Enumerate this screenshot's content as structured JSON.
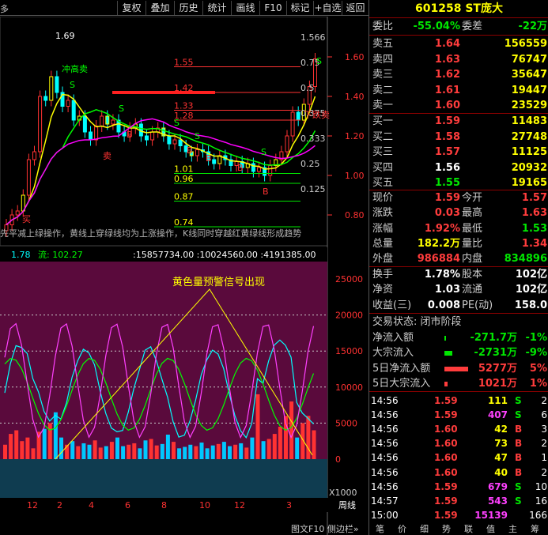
{
  "toolbar": {
    "left_label": "多",
    "buttons": [
      "复权",
      "叠加",
      "历史",
      "统计",
      "画线",
      "F10",
      "标记",
      "+自选",
      "返回"
    ]
  },
  "stock": {
    "code": "601258",
    "name": "ST庞大"
  },
  "order_book": {
    "weibi_label": "委比",
    "weibi": "-55.04%",
    "weicha_label": "委差",
    "weicha": "-22万",
    "asks": [
      {
        "label": "卖五",
        "price": "1.64",
        "vol": "156559"
      },
      {
        "label": "卖四",
        "price": "1.63",
        "vol": "76747"
      },
      {
        "label": "卖三",
        "price": "1.62",
        "vol": "35647"
      },
      {
        "label": "卖二",
        "price": "1.61",
        "vol": "19447"
      },
      {
        "label": "卖一",
        "price": "1.60",
        "vol": "23529"
      }
    ],
    "bids": [
      {
        "label": "买一",
        "price": "1.59",
        "vol": "11483"
      },
      {
        "label": "买二",
        "price": "1.58",
        "vol": "27748"
      },
      {
        "label": "买三",
        "price": "1.57",
        "vol": "11125"
      },
      {
        "label": "买四",
        "price": "1.56",
        "vol": "20932"
      },
      {
        "label": "买五",
        "price": "1.55",
        "vol": "19165"
      }
    ]
  },
  "quote": [
    {
      "l1": "现价",
      "v1": "1.59",
      "l2": "今开",
      "v2": "1.57"
    },
    {
      "l1": "涨跌",
      "v1": "0.03",
      "l2": "最高",
      "v2": "1.63"
    },
    {
      "l1": "涨幅",
      "v1": "1.92%",
      "l2": "最低",
      "v2": "1.53"
    },
    {
      "l1": "总量",
      "v1": "182.2万",
      "l2": "量比",
      "v2": "1.34"
    },
    {
      "l1": "外盘",
      "v1": "986884",
      "l2": "内盘",
      "v2": "834896"
    }
  ],
  "stats": [
    {
      "l1": "换手",
      "v1": "1.78%",
      "l2": "股本",
      "v2": "102亿"
    },
    {
      "l1": "净资",
      "v1": "1.03",
      "l2": "流通",
      "v2": "102亿"
    },
    {
      "l1": "收益(三)",
      "v1": "0.008",
      "l2": "PE(动)",
      "v2": "158.0"
    }
  ],
  "status": "交易状态: 闭市阶段",
  "flows": [
    {
      "label": "净流入额",
      "value": "-271.7万",
      "pct": "-1%"
    },
    {
      "label": "大宗流入",
      "value": "-2731万",
      "pct": "-9%"
    },
    {
      "label": "5日净流入额",
      "value": "5277万",
      "pct": "5%"
    },
    {
      "label": "5日大宗流入",
      "value": "1021万",
      "pct": "1%"
    }
  ],
  "ticks": [
    {
      "t": "14:56",
      "p": "1.59",
      "v": "111",
      "s": "S",
      "n": "2"
    },
    {
      "t": "14:56",
      "p": "1.59",
      "v": "407",
      "s": "S",
      "n": "6"
    },
    {
      "t": "14:56",
      "p": "1.60",
      "v": "42",
      "s": "B",
      "n": "3"
    },
    {
      "t": "14:56",
      "p": "1.60",
      "v": "73",
      "s": "B",
      "n": "2"
    },
    {
      "t": "14:56",
      "p": "1.60",
      "v": "47",
      "s": "B",
      "n": "1"
    },
    {
      "t": "14:56",
      "p": "1.60",
      "v": "40",
      "s": "B",
      "n": "2"
    },
    {
      "t": "14:56",
      "p": "1.59",
      "v": "679",
      "s": "S",
      "n": "10"
    },
    {
      "t": "14:57",
      "p": "1.59",
      "v": "543",
      "s": "S",
      "n": "16"
    },
    {
      "t": "15:00",
      "p": "1.59",
      "v": "15139",
      "s": "",
      "n": "166"
    }
  ],
  "bottom_tabs": [
    "笔",
    "价",
    "细",
    "势",
    "联",
    "值",
    "主",
    "筹"
  ],
  "chart": {
    "price_ticks": [
      "1.60",
      "1.40",
      "1.20",
      "1.00",
      "0.80"
    ],
    "high_label": "1.69",
    "fib_levels": [
      "1.55",
      "1.42",
      "1.33",
      "1.28",
      "1.01",
      "0.96",
      "0.87",
      "0.74"
    ],
    "fib_right": [
      "1.566",
      "0.75",
      "0.5",
      "0.375",
      "0.333",
      "0.25",
      "0.125"
    ],
    "signal_labels": [
      "冲高卖",
      "S",
      "S",
      "S",
      "S",
      "S",
      "B",
      "B",
      "B",
      "B",
      "B",
      "卖",
      "买",
      "下跌卖",
      "S"
    ],
    "formula_text": "先平减上绿操作，黄线上穿绿线均为上涨操作，K线同时穿越红黄绿线形成趋势",
    "indicator_header": "1.78",
    "indicator_flow_label": "流: 102.27",
    "indicator_values": ":15857734.00 :10024560.00 :4191385.00",
    "indicator_title": "黄色量预警信号出现",
    "vol_ticks": [
      "25000",
      "20000",
      "15000",
      "10000",
      "5000",
      "0"
    ],
    "x_labels": [
      "12",
      "2",
      "4",
      "6",
      "8",
      "10",
      "12",
      "3"
    ],
    "x1000": "X1000",
    "zhouxian": "周线",
    "bottom_links": "图文F10 侧边栏»",
    "colors": {
      "up": "#ff3232",
      "down": "#00ffff",
      "ma_yellow": "#ffff00",
      "ma_green": "#00ff00",
      "ma_magenta": "#ff00ff",
      "panel_bg": "#5a0a3c"
    }
  }
}
